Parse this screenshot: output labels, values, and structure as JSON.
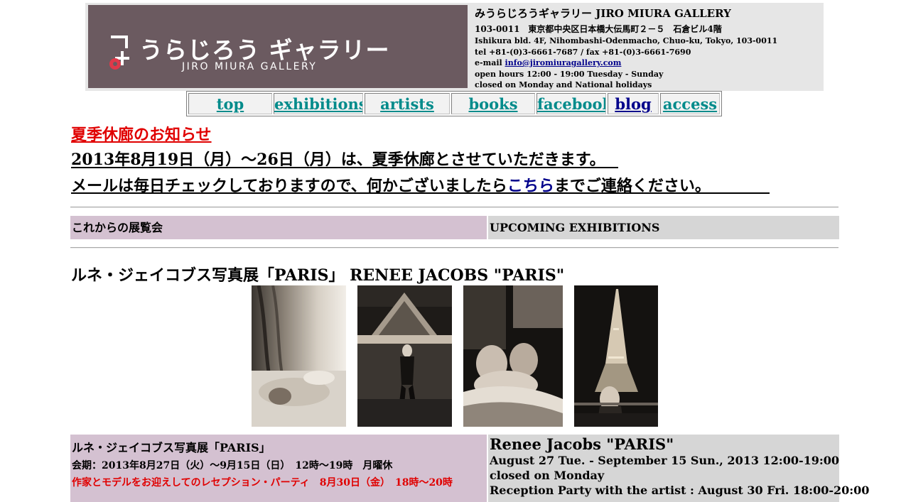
{
  "header": {
    "logo_jp": "うらじろう ギャラリー",
    "logo_en": "JIRO MIURA GALLERY",
    "gallery_name": "みうらじろうギャラリー JIRO MIURA GALLERY",
    "address_jp": "103-0011　東京都中央区日本橋大伝馬町２－５　石倉ビル4階",
    "address_en": "Ishikura bld. 4F, Nihombashi-Odenmacho, Chuo-ku, Tokyo, 103-0011",
    "phone": "tel +81-(0)3-6661-7687 / fax +81-(0)3-6661-7690",
    "email_prefix": "e-mail ",
    "email": "info@jiromiuragallery.com",
    "hours": "open hours 12:00 - 19:00 Tuesday - Sunday",
    "closed": "closed on Monday and National holidays"
  },
  "nav": {
    "items": [
      "top",
      "exhibitions",
      "artists",
      "books",
      "facebook",
      "blog",
      "access"
    ]
  },
  "notice": {
    "title": "夏季休廊のお知らせ",
    "line1": "2013年8月19日（月）～26日（月）は、夏季休廊とさせていただきます。",
    "line2_pre": "メールは毎日チェックしておりますので、何かございましたら",
    "line2_link": "こちら",
    "line2_post": "までご連絡ください。"
  },
  "upcoming": {
    "jp": "これからの展覧会",
    "en": "UPCOMING EXHIBITIONS"
  },
  "exhibition": {
    "heading": "ルネ・ジェイコブス写真展「PARIS」 RENEE JACOBS \"PARIS\"",
    "jp_title": "ルネ・ジェイコブス写真展「PARIS」",
    "jp_dates": "会期：2013年8月27日（火）～9月15日（日）　12時～19時　月曜休",
    "jp_reception": "作家とモデルをお迎えしてのレセプション・パーティ　8月30日（金）　18時～20時",
    "en_title": "Renee Jacobs \"PARIS\"",
    "en_dates": "August 27 Tue. - September 15 Sun., 2013 12:00-19:00",
    "en_closed": "closed on Monday",
    "en_reception": "Reception Party with the artist : August 30 Fri. 18:00-20:00"
  },
  "colors": {
    "logo_bg": "#6b5a60",
    "header_bg": "#e6e6e6",
    "nav_link": "#008b8b",
    "notice_red": "#e00000",
    "jp_band": "#d4c1d1",
    "en_band": "#d6d6d6"
  }
}
